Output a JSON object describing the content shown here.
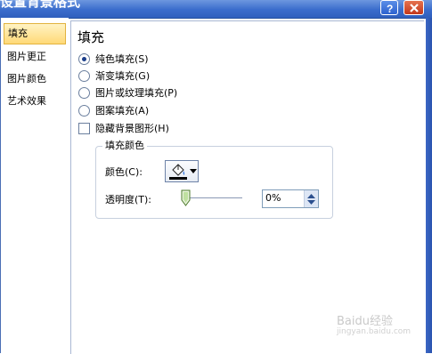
{
  "window": {
    "title": "设置背景格式"
  },
  "nav": {
    "items": [
      {
        "label": "填充",
        "selected": true
      },
      {
        "label": "图片更正"
      },
      {
        "label": "图片颜色"
      },
      {
        "label": "艺术效果"
      }
    ]
  },
  "fill": {
    "heading": "填充",
    "options": [
      {
        "label": "纯色填充(S)",
        "checked": true
      },
      {
        "label": "渐变填充(G)"
      },
      {
        "label": "图片或纹理填充(P)"
      },
      {
        "label": "图案填充(A)"
      }
    ],
    "hide_bg_label": "隐藏背景图形(H)",
    "group_title": "填充颜色",
    "color_label": "颜色(C):",
    "transparency_label": "透明度(T):",
    "transparency_value": "0%"
  },
  "watermark": {
    "text": "Baidu经验",
    "sub": "jingyan.baidu.com"
  }
}
